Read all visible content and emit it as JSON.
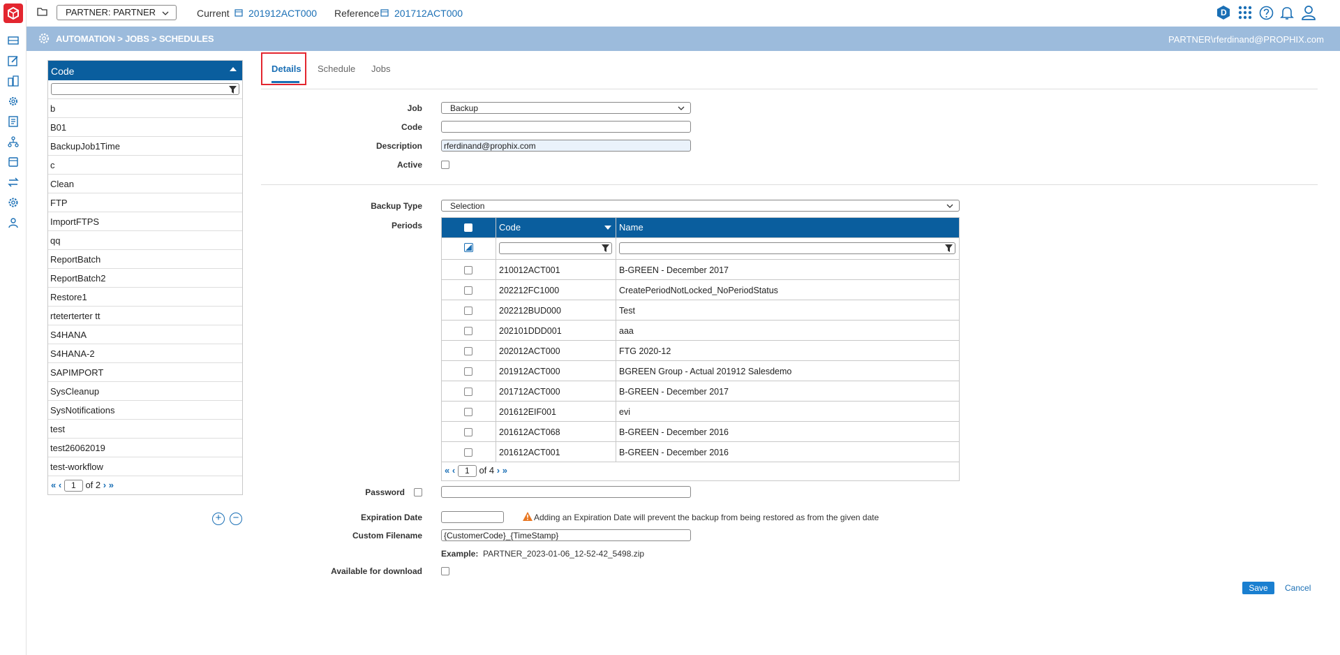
{
  "topbar": {
    "partner_select": "PARTNER: PARTNER",
    "current_label": "Current",
    "current_value": "201912ACT000",
    "reference_label": "Reference",
    "reference_value": "201712ACT000",
    "user_initial": "D"
  },
  "breadcrumb": {
    "path": "AUTOMATION > JOBS > SCHEDULES",
    "user": "PARTNER\\rferdinand@PROPHIX.com"
  },
  "codelist": {
    "header": "Code",
    "items": [
      "b",
      "B01",
      "BackupJob1Time",
      "c",
      "Clean",
      "FTP",
      "ImportFTPS",
      "qq",
      "ReportBatch",
      "ReportBatch2",
      "Restore1",
      "rteterterter tt",
      "S4HANA",
      "S4HANA-2",
      "SAPIMPORT",
      "SysCleanup",
      "SysNotifications",
      "test",
      "test26062019",
      "test-workflow"
    ],
    "page": "1",
    "of_label": "of",
    "total_pages": "2"
  },
  "tabs": [
    "Details",
    "Schedule",
    "Jobs"
  ],
  "form": {
    "job_label": "Job",
    "job_value": "Backup",
    "code_label": "Code",
    "code_value": "",
    "description_label": "Description",
    "description_value": "rferdinand@prophix.com",
    "active_label": "Active",
    "backup_type_label": "Backup Type",
    "backup_type_value": "Selection",
    "periods_label": "Periods",
    "password_label": "Password",
    "expiration_label": "Expiration Date",
    "expiration_note": "Adding an Expiration Date will prevent the backup from being restored as from the given date",
    "custom_filename_label": "Custom Filename",
    "custom_filename_value": "{CustomerCode}_{TimeStamp}",
    "example_label": "Example:",
    "example_value": "PARTNER_2023-01-06_12-52-42_5498.zip",
    "available_label": "Available for download"
  },
  "periods": {
    "col_code": "Code",
    "col_name": "Name",
    "rows": [
      {
        "code": "210012ACT001",
        "name": "B-GREEN - December 2017"
      },
      {
        "code": "202212FC1000",
        "name": "CreatePeriodNotLocked_NoPeriodStatus"
      },
      {
        "code": "202212BUD000",
        "name": "Test"
      },
      {
        "code": "202101DDD001",
        "name": "aaa"
      },
      {
        "code": "202012ACT000",
        "name": "FTG 2020-12"
      },
      {
        "code": "201912ACT000",
        "name": "BGREEN Group - Actual 201912 Salesdemo"
      },
      {
        "code": "201712ACT000",
        "name": "B-GREEN - December 2017"
      },
      {
        "code": "201612EIF001",
        "name": "evi"
      },
      {
        "code": "201612ACT068",
        "name": "B-GREEN - December 2016"
      },
      {
        "code": "201612ACT001",
        "name": "B-GREEN - December 2016"
      }
    ],
    "page": "1",
    "of_label": "of",
    "total_pages": "4"
  },
  "actions": {
    "save": "Save",
    "cancel": "Cancel"
  },
  "colors": {
    "brand_red": "#e3262f",
    "header_blue": "#0a5e9e",
    "crumb_blue": "#9cbbdc",
    "link_blue": "#1a6fb5",
    "warning": "#e87722"
  }
}
